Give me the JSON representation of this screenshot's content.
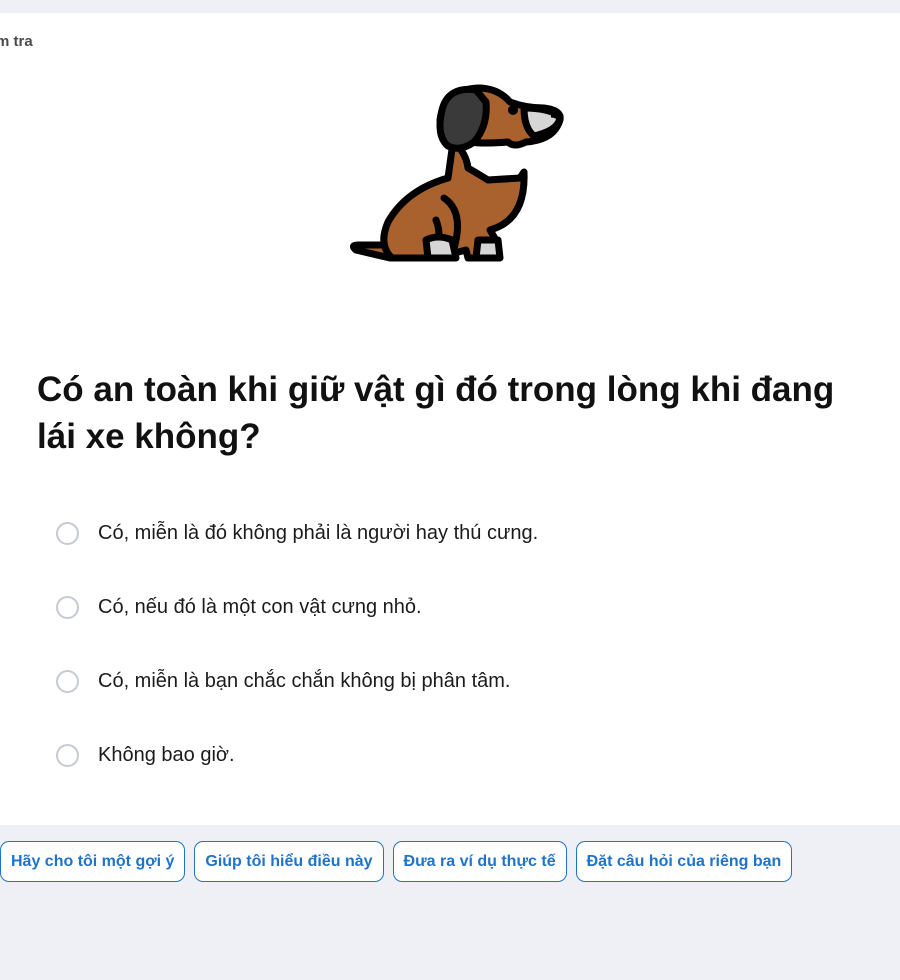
{
  "card": {
    "label": "m tra"
  },
  "illustration": {
    "icon": "dog-icon",
    "colors": {
      "body": "#a9622e",
      "ear": "#3a3a3a",
      "snout": "#d6d6d6",
      "outline": "#000000"
    }
  },
  "question": {
    "text": "Có an toàn khi giữ vật gì đó trong lòng khi đang lái xe không?"
  },
  "options": [
    {
      "label": "Có, miễn là đó không phải là người hay thú cưng."
    },
    {
      "label": "Có, nếu đó là một con vật cưng nhỏ."
    },
    {
      "label": "Có, miễn là bạn chắc chắn không bị phân tâm."
    },
    {
      "label": "Không bao giờ."
    }
  ],
  "suggestions": [
    {
      "label": "Hãy cho tôi một gợi ý"
    },
    {
      "label": "Giúp tôi hiểu điều này"
    },
    {
      "label": "Đưa ra ví dụ thực tế"
    },
    {
      "label": "Đặt câu hỏi của riêng bạn"
    }
  ],
  "colors": {
    "background": "#eff0f5",
    "card": "#ffffff",
    "accent": "#1f73c9",
    "radio_border": "#c7c9d3"
  }
}
